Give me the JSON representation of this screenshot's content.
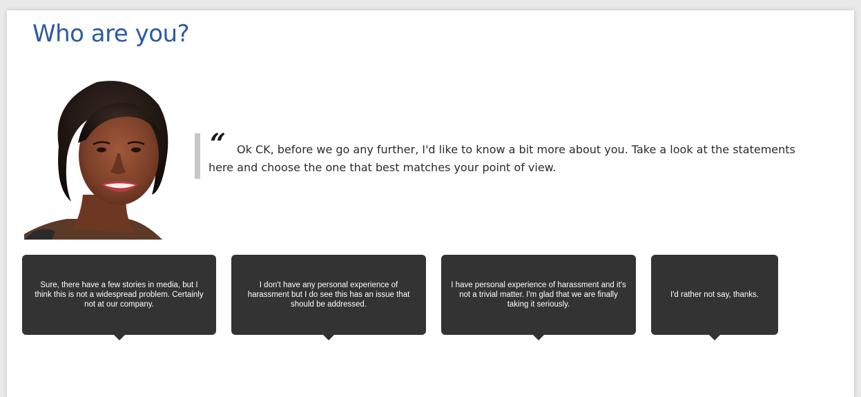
{
  "page": {
    "title": "Who are you?"
  },
  "character": {
    "portrait_icon": "woman-portrait-icon",
    "quote_mark": "“",
    "speech": "Ok CK, before we go any further, I'd like to know a bit more about you. Take a look at the statements here and choose the one that best matches your point of view."
  },
  "options": [
    {
      "label": "Sure, there have a few stories in media, but I think this is not a widespread problem. Certainly not at our company."
    },
    {
      "label": "I don't have any personal experience of harassment but I do see this has an issue that should be addressed."
    },
    {
      "label": "I have personal experience of harassment and it's not a trivial matter. I'm glad that we are finally taking it seriously."
    },
    {
      "label": "I'd rather not say, thanks."
    }
  ],
  "colors": {
    "title": "#2c5aa0",
    "option_background": "#333333",
    "option_text": "#ffffff",
    "quote_bar": "#c8c8c8"
  }
}
